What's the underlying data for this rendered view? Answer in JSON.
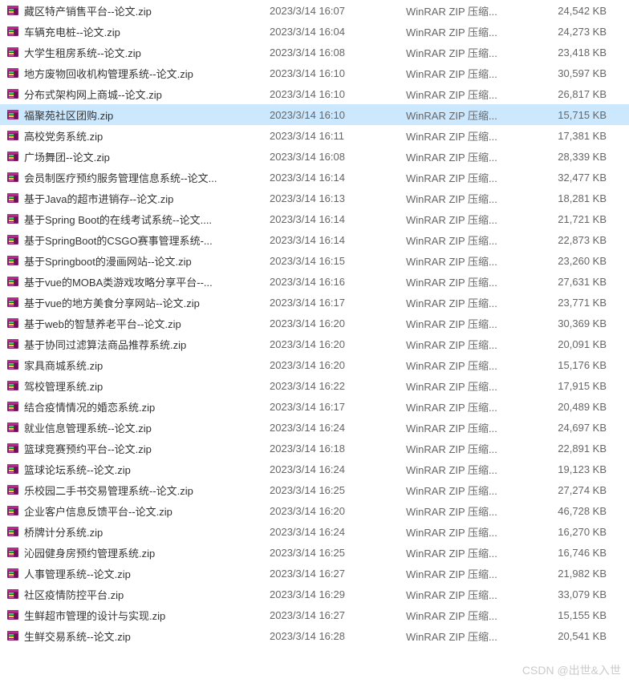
{
  "type_label": "WinRAR ZIP 压缩...",
  "size_unit": "KB",
  "watermark": "CSDN @出世&入世",
  "files": [
    {
      "name": "藏区特产销售平台--论文.zip",
      "date": "2023/3/14 16:07",
      "size": "24,542",
      "selected": false
    },
    {
      "name": "车辆充电桩--论文.zip",
      "date": "2023/3/14 16:04",
      "size": "24,273",
      "selected": false
    },
    {
      "name": "大学生租房系统--论文.zip",
      "date": "2023/3/14 16:08",
      "size": "23,418",
      "selected": false
    },
    {
      "name": "地方废物回收机构管理系统--论文.zip",
      "date": "2023/3/14 16:10",
      "size": "30,597",
      "selected": false
    },
    {
      "name": "分布式架构网上商城--论文.zip",
      "date": "2023/3/14 16:10",
      "size": "26,817",
      "selected": false
    },
    {
      "name": "福聚苑社区团购.zip",
      "date": "2023/3/14 16:10",
      "size": "15,715",
      "selected": true
    },
    {
      "name": "高校党务系统.zip",
      "date": "2023/3/14 16:11",
      "size": "17,381",
      "selected": false
    },
    {
      "name": "广场舞团--论文.zip",
      "date": "2023/3/14 16:08",
      "size": "28,339",
      "selected": false
    },
    {
      "name": "会员制医疗预约服务管理信息系统--论文...",
      "date": "2023/3/14 16:14",
      "size": "32,477",
      "selected": false
    },
    {
      "name": "基于Java的超市进销存--论文.zip",
      "date": "2023/3/14 16:13",
      "size": "18,281",
      "selected": false
    },
    {
      "name": "基于Spring Boot的在线考试系统--论文....",
      "date": "2023/3/14 16:14",
      "size": "21,721",
      "selected": false
    },
    {
      "name": "基于SpringBoot的CSGO赛事管理系统-...",
      "date": "2023/3/14 16:14",
      "size": "22,873",
      "selected": false
    },
    {
      "name": "基于Springboot的漫画网站--论文.zip",
      "date": "2023/3/14 16:15",
      "size": "23,260",
      "selected": false
    },
    {
      "name": "基于vue的MOBA类游戏攻略分享平台--...",
      "date": "2023/3/14 16:16",
      "size": "27,631",
      "selected": false
    },
    {
      "name": "基于vue的地方美食分享网站--论文.zip",
      "date": "2023/3/14 16:17",
      "size": "23,771",
      "selected": false
    },
    {
      "name": "基于web的智慧养老平台--论文.zip",
      "date": "2023/3/14 16:20",
      "size": "30,369",
      "selected": false
    },
    {
      "name": "基于协同过滤算法商品推荐系统.zip",
      "date": "2023/3/14 16:20",
      "size": "20,091",
      "selected": false
    },
    {
      "name": "家具商城系统.zip",
      "date": "2023/3/14 16:20",
      "size": "15,176",
      "selected": false
    },
    {
      "name": "驾校管理系统.zip",
      "date": "2023/3/14 16:22",
      "size": "17,915",
      "selected": false
    },
    {
      "name": "结合疫情情况的婚恋系统.zip",
      "date": "2023/3/14 16:17",
      "size": "20,489",
      "selected": false
    },
    {
      "name": "就业信息管理系统--论文.zip",
      "date": "2023/3/14 16:24",
      "size": "24,697",
      "selected": false
    },
    {
      "name": "篮球竞赛预约平台--论文.zip",
      "date": "2023/3/14 16:18",
      "size": "22,891",
      "selected": false
    },
    {
      "name": "篮球论坛系统--论文.zip",
      "date": "2023/3/14 16:24",
      "size": "19,123",
      "selected": false
    },
    {
      "name": "乐校园二手书交易管理系统--论文.zip",
      "date": "2023/3/14 16:25",
      "size": "27,274",
      "selected": false
    },
    {
      "name": "企业客户信息反馈平台--论文.zip",
      "date": "2023/3/14 16:20",
      "size": "46,728",
      "selected": false
    },
    {
      "name": "桥牌计分系统.zip",
      "date": "2023/3/14 16:24",
      "size": "16,270",
      "selected": false
    },
    {
      "name": "沁园健身房预约管理系统.zip",
      "date": "2023/3/14 16:25",
      "size": "16,746",
      "selected": false
    },
    {
      "name": "人事管理系统--论文.zip",
      "date": "2023/3/14 16:27",
      "size": "21,982",
      "selected": false
    },
    {
      "name": "社区疫情防控平台.zip",
      "date": "2023/3/14 16:29",
      "size": "33,079",
      "selected": false
    },
    {
      "name": "生鲜超市管理的设计与实现.zip",
      "date": "2023/3/14 16:27",
      "size": "15,155",
      "selected": false
    },
    {
      "name": "生鲜交易系统--论文.zip",
      "date": "2023/3/14 16:28",
      "size": "20,541",
      "selected": false
    }
  ]
}
